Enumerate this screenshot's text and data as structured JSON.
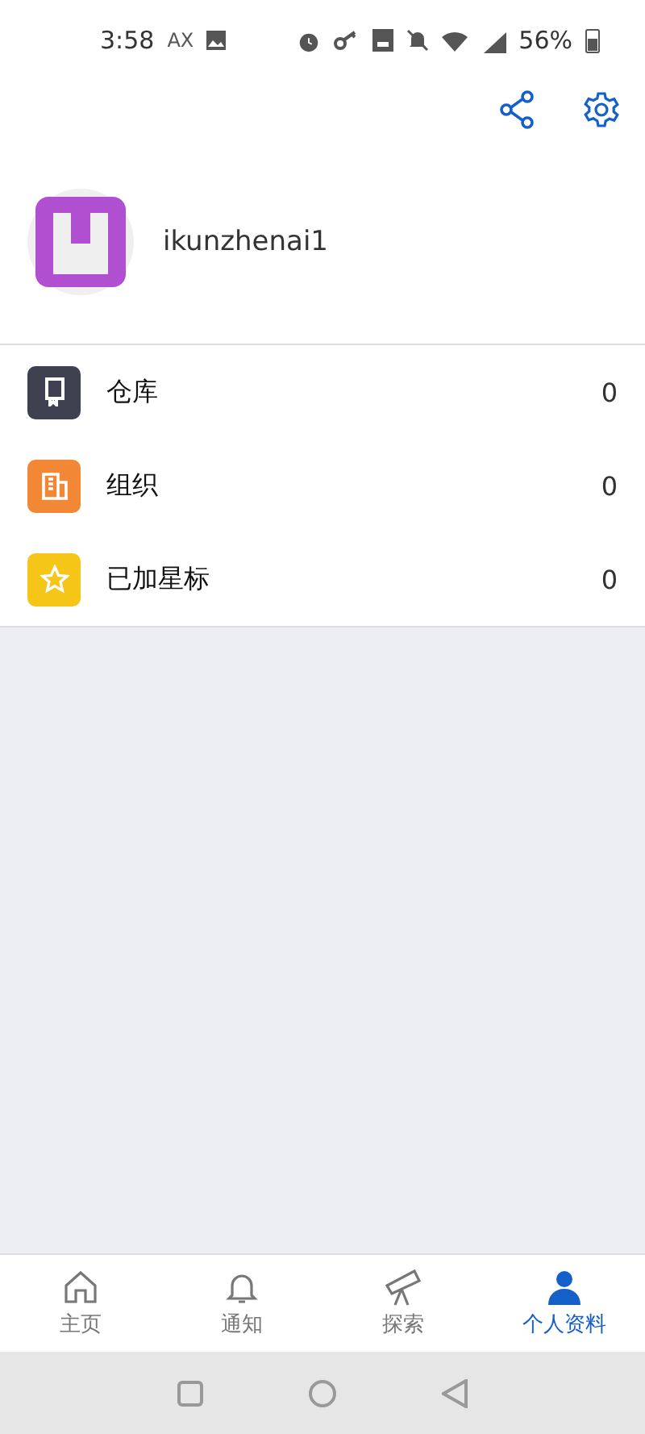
{
  "status_bar": {
    "time": "3:58",
    "carrier": "AX",
    "battery": "56%"
  },
  "profile": {
    "username": "ikunzhenai1"
  },
  "items": [
    {
      "kind": "repo",
      "label": "仓库",
      "count": "0",
      "color": "#3f4150"
    },
    {
      "kind": "org",
      "label": "组织",
      "count": "0",
      "color": "#f28735"
    },
    {
      "kind": "star",
      "label": "已加星标",
      "count": "0",
      "color": "#f5c518"
    }
  ],
  "tabs": [
    {
      "kind": "home",
      "label": "主页",
      "selected": false
    },
    {
      "kind": "bell",
      "label": "通知",
      "selected": false
    },
    {
      "kind": "telescope",
      "label": "探索",
      "selected": false
    },
    {
      "kind": "person",
      "label": "个人资料",
      "selected": true
    }
  ]
}
